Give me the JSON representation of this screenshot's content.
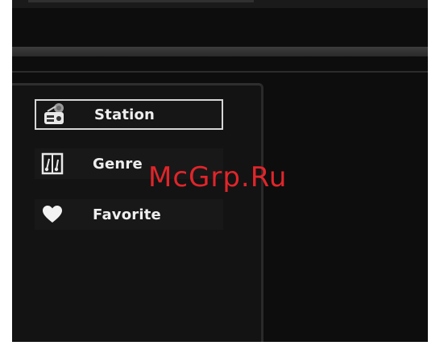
{
  "menu": {
    "items": [
      {
        "label": "Station",
        "icon": "radio-icon",
        "selected": true
      },
      {
        "label": "Genre",
        "icon": "genre-icon",
        "selected": false
      },
      {
        "label": "Favorite",
        "icon": "heart-icon",
        "selected": false
      }
    ]
  },
  "watermark": "McGrp.Ru",
  "colors": {
    "background": "#0d0d0d",
    "panel": "#131313",
    "text": "#eeeeee",
    "selection_border": "#d6d6d6",
    "watermark": "#e0252a"
  }
}
